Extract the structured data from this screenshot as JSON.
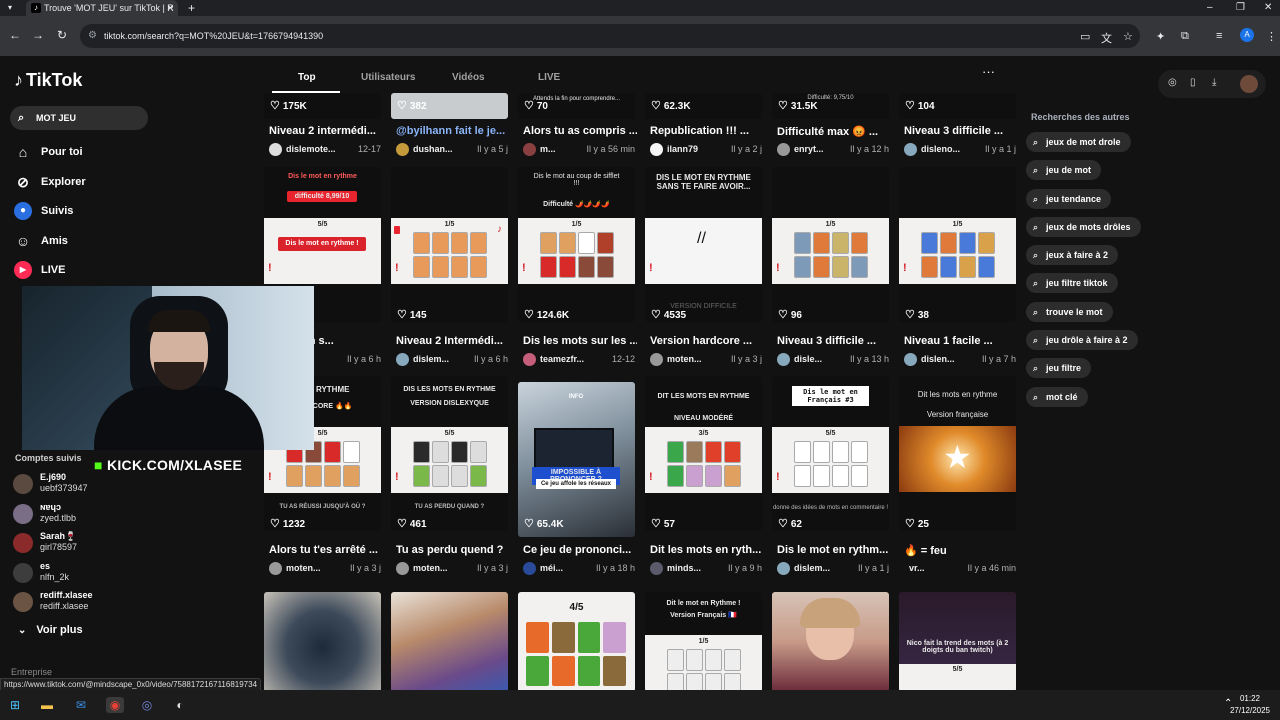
{
  "browser": {
    "tab_title": "Trouve 'MOT JEU' sur TikTok | R",
    "tab_favicon": "♪",
    "tab_close": "✕",
    "new_tab": "+",
    "url": "tiktok.com/search?q=MOT%20JEU&t=1766794941390",
    "profile_letter": "A",
    "status_url": "https://www.tiktok.com/@mindscape_0x0/video/7588172167116819734"
  },
  "tiktok": {
    "logo": "TikTok",
    "search_value": "MOT JEU",
    "nav": [
      {
        "label": "Pour toi",
        "icon": "home-icon"
      },
      {
        "label": "Explorer",
        "icon": "compass-icon"
      },
      {
        "label": "Suivis",
        "icon": "following-icon"
      },
      {
        "label": "Amis",
        "icon": "friends-icon"
      },
      {
        "label": "LIVE",
        "icon": "live-icon"
      }
    ],
    "tabs": [
      "Top",
      "Utilisateurs",
      "Vidéos",
      "LIVE"
    ],
    "followed_header": "Comptes suivis",
    "followed": [
      {
        "name": "E.j690",
        "handle": "uebf373947"
      },
      {
        "name": "ɴɐɥɔ",
        "handle": "zyed.tlbb"
      },
      {
        "name": "Sarah🍷",
        "handle": "girl78597"
      },
      {
        "name": "es",
        "handle": "nlfn_2k"
      },
      {
        "name": "rediff.xlasee",
        "handle": "rediff.xlasee"
      }
    ],
    "see_more": "Voir plus",
    "entreprise": "Entreprise",
    "overlay_kick": "KICK.COM/XLASEE",
    "others_header": "Recherches des autres",
    "others": [
      "jeux de mot drole",
      "jeu de mot",
      "jeu tendance",
      "jeux de mots drôles",
      "jeux à faire à 2",
      "jeu filtre tiktok",
      "trouve le mot",
      "jeu drôle à faire à 2",
      "jeu filtre",
      "mot clé"
    ]
  },
  "videos": [
    {
      "likes": "175K",
      "title": "Niveau 2 intermédi...",
      "author": "dislemote...",
      "time": "12-17"
    },
    {
      "likes": "382",
      "title": "@byilhann fait le je...",
      "author": "dushan...",
      "time": "Il y a 5 j"
    },
    {
      "likes": "70",
      "title": "Alors tu as compris ...",
      "author": "m...",
      "time": "Il y a 56 min"
    },
    {
      "likes": "62.3K",
      "title": "Republication !!! ...",
      "author": "ilann79",
      "time": "Il y a 2 j"
    },
    {
      "likes": "31.5K",
      "title": "Difficulté max 😡 ...",
      "author": "enryt...",
      "time": "Il y a 12 h"
    },
    {
      "likes": "104",
      "title": "Niveau 3 difficile ...",
      "author": "disleno...",
      "time": "Il y a 1 j"
    },
    {
      "likes": "",
      "title": "nous ton s...",
      "author": "",
      "time": "Il y a 6 h"
    },
    {
      "likes": "145",
      "title": "Niveau 2 Intermédi...",
      "author": "dislem...",
      "time": "Il y a 6 h"
    },
    {
      "likes": "124.6K",
      "title": "Dis les mots sur les ...",
      "author": "teamezfr...",
      "time": "12-12"
    },
    {
      "likes": "4535",
      "title": "Version hardcore ...",
      "author": "moten...",
      "time": "Il y a 3 j"
    },
    {
      "likes": "96",
      "title": "Niveau 3 difficile ...",
      "author": "disle...",
      "time": "Il y a 13 h"
    },
    {
      "likes": "38",
      "title": "Niveau 1 facile ...",
      "author": "dislen...",
      "time": "Il y a 7 h"
    },
    {
      "likes": "1232",
      "title": "Alors tu t'es arrêté ...",
      "author": "moten...",
      "time": "Il y a 3 j"
    },
    {
      "likes": "461",
      "title": "Tu as perdu quend ?",
      "author": "moten...",
      "time": "Il y a 3 j"
    },
    {
      "likes": "65.4K",
      "title": "Ce jeu de prononci...",
      "author": "méi...",
      "time": "Il y a 18 h"
    },
    {
      "likes": "57",
      "title": "Dit les mots en ryth...",
      "author": "minds...",
      "time": "Il y a 9 h"
    },
    {
      "likes": "62",
      "title": "Dis le mot en rythm...",
      "author": "dislem...",
      "time": "Il y a 1 j"
    },
    {
      "likes": "25",
      "title": "🔥 = feu",
      "author": "vr...",
      "time": "Il y a 46 min"
    }
  ],
  "captions": {
    "r1c3_top": "Attends la fin pour comprendre...",
    "r1c5_top": "Difficulté: 9,75/10",
    "r2c1_a": "Dis le mot en rythme",
    "r2c1_b": "difficulté 8,99/10",
    "r2c1_game": "Dis le mot en rythme !",
    "r2c3_a": "Dis le mot au coup de sifflet !!!",
    "r2c3_b": "Difficulté 🌶️🌶️🌶️🌶️",
    "r2c4_a": "DIS LE MOT EN RYTHME SANS TE FAIRE AVOIR...",
    "r2c4_b": "VERSION DIFFICILE",
    "r3c1_a": "T EN RYTHME",
    "r3c1_b": "HARDCORE 🔥🔥",
    "r3c2_a": "DIS LES MOTS EN RYTHME",
    "r3c2_b": "VERSION DISLEXYQUE",
    "r3c3_a": "IMPOSSIBLE À PRONONCER ?",
    "r3c3_b": "Ce jeu affole les réseaux",
    "r3c3_c": "INFO",
    "r3c4_a": "DIT LES MOTS EN RYTHME",
    "r3c4_b": "NIVEAU MODÉRÉ",
    "r3c5_a": "Dis le mot en Français #3",
    "r3c5_b": "donne des idées de mots en commentaire !",
    "r3c6_a": "Dit les mots en rythme",
    "r3c6_b": "Version française",
    "r3c1_c": "TU AS RÉUSSI JUSQU'À OÙ ?",
    "r3c2_c": "TU AS PERDU QUAND ?",
    "r4c3_score": "4/5",
    "r4c4_a": "Dit le mot en Rythme !",
    "r4c4_b": "Version Français 🇫🇷",
    "r4c6_a": "Nico fait la trend des mots (à 2 doigts du ban twitch)",
    "r4c6_score": "5/5"
  },
  "game_scores": {
    "r2c1": "5/5",
    "r2c2": "1/5",
    "r2c3": "1/5",
    "r2c5": "1/5",
    "r2c6": "1/5",
    "r3c1": "5/5",
    "r3c2": "5/5",
    "r3c4": "3/5",
    "r3c5": "5/5",
    "r4c4": "1/5"
  },
  "taskbar": {
    "time": "01:22",
    "date": "27/12/2025"
  },
  "colors": {
    "accent": "#fe2c55",
    "kick_green": "#53fc18",
    "background": "#121212"
  }
}
